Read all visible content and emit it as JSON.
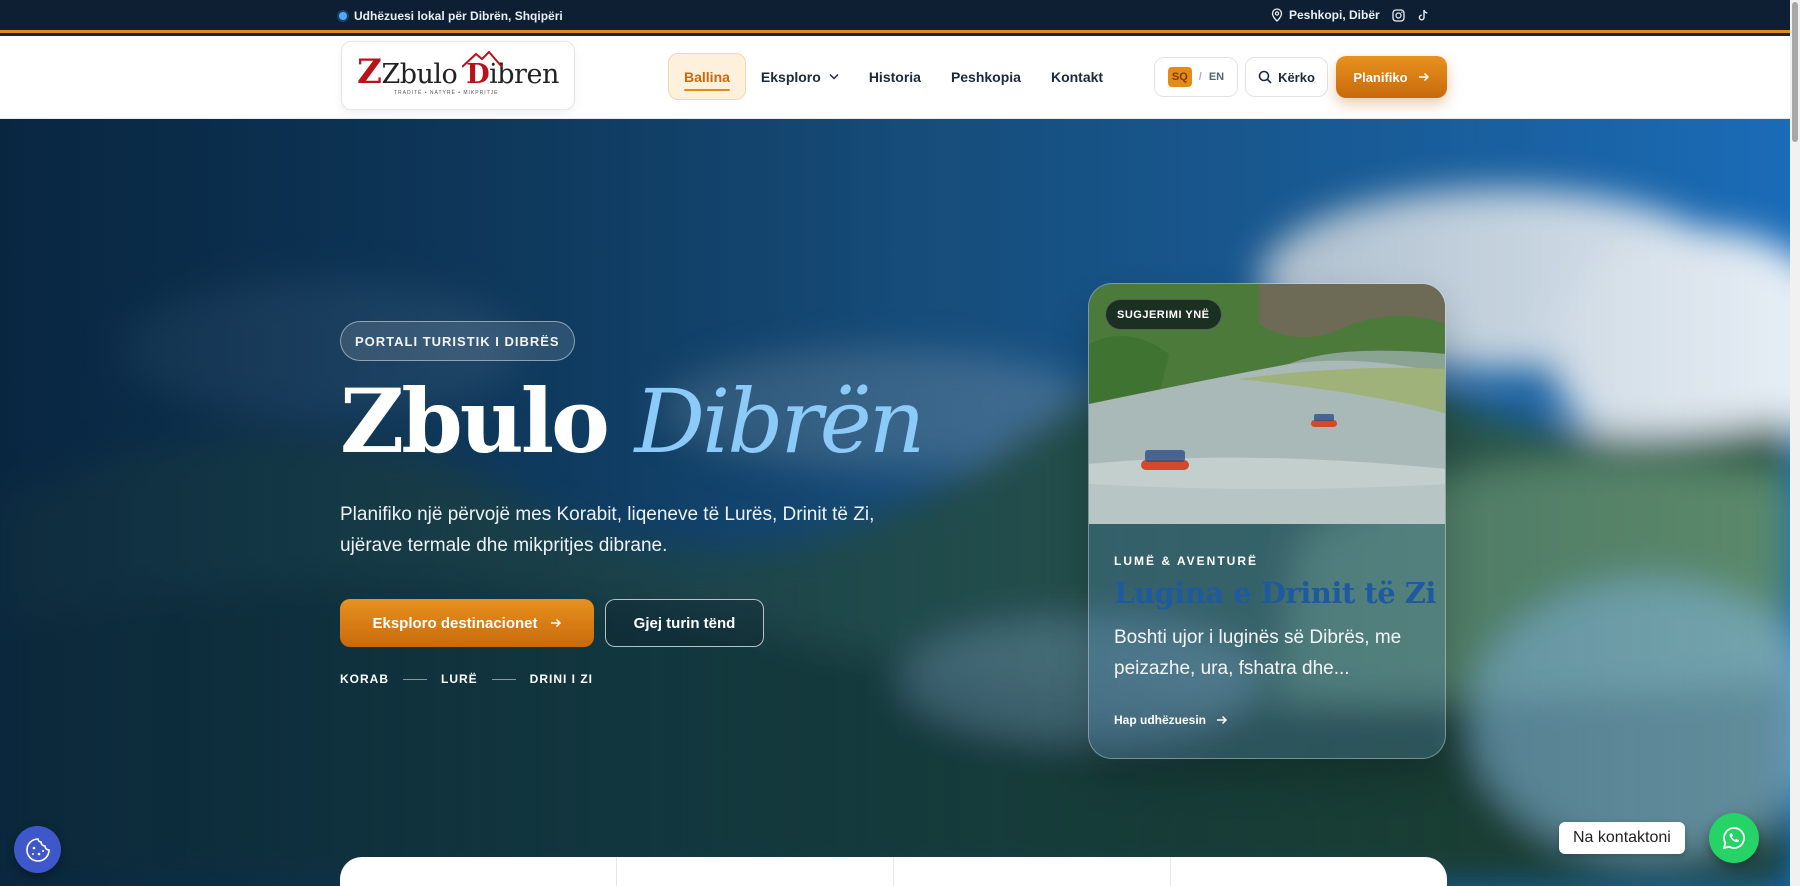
{
  "topbar": {
    "guide_text": "Udhëzuesi lokal për Dibrën, Shqipëri",
    "location": "Peshkopi, Dibër",
    "icons": [
      "location-pin-icon",
      "instagram-icon",
      "tiktok-icon"
    ]
  },
  "nav": {
    "logo_text_a": "Zbulo",
    "logo_text_b": "ibren",
    "logo_tagline": "TRADITË • NATYRË • MIKPRITJE",
    "items": [
      {
        "label": "Ballina",
        "active": true
      },
      {
        "label": "Eksploro",
        "dropdown": true
      },
      {
        "label": "Historia"
      },
      {
        "label": "Peshkopia"
      },
      {
        "label": "Kontakt"
      }
    ],
    "lang_active": "SQ",
    "lang_sep": "/",
    "lang_other": "EN",
    "search_label": "Kërko",
    "plan_label": "Planifiko"
  },
  "hero": {
    "pill": "PORTALI TURISTIK I DIBRËS",
    "title_a": "Zbulo",
    "title_b": "Dibrën",
    "lead": "Planifiko një përvojë mes Korabit, liqeneve të Lurës, Drinit të Zi, ujërave termale dhe mikpritjes dibrane.",
    "cta_primary": "Eksploro destinacionet",
    "cta_secondary": "Gjej turin tënd",
    "places": [
      "KORAB",
      "LURË",
      "DRINI I ZI"
    ]
  },
  "card": {
    "badge": "SUGJERIMI YNË",
    "kicker": "LUMË & AVENTURË",
    "title": "Lugina e Drinit të Zi",
    "desc": "Boshti ujor i luginës së Dibrës, me peizazhe, ura, fshatra dhe...",
    "link": "Hap udhëzuesin"
  },
  "widgets": {
    "contact_label": "Na kontaktoni"
  },
  "colors": {
    "accent": "#e58a17",
    "topbar_bg": "#0e1f33",
    "hero_accent": "#8ccaf7",
    "card_title": "#1f5aa0",
    "whatsapp": "#25d366"
  }
}
